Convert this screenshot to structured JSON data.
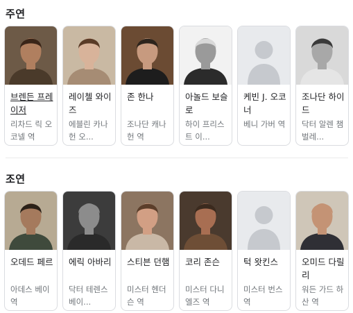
{
  "lead": {
    "title": "주연",
    "cards": [
      {
        "name": "브렌든 프레이저",
        "role": "리차드 릭 오코넬 역",
        "photo": "person-photo",
        "skin": "#b07f5f",
        "hair": "#3a2518",
        "bg": "#6d5a47",
        "shirt": "#4a3a2a"
      },
      {
        "name": "레이첼 와이즈",
        "role": "에블린 카나헌 오...",
        "photo": "person-photo",
        "skin": "#d8b39a",
        "hair": "#5a3b27",
        "bg": "#c9b9a3",
        "shirt": "#a68c74"
      },
      {
        "name": "존 한나",
        "role": "조나단 캐나헌 역",
        "photo": "person-photo",
        "skin": "#c79a7f",
        "hair": "#2d241c",
        "bg": "#6b4b33",
        "shirt": "#1d1d1d"
      },
      {
        "name": "아놀드 보슬로",
        "role": "하이 프리스트 이...",
        "photo": "person-photo-bw",
        "skin": "#9a9a9a",
        "hair": "#d9d9d9",
        "bg": "#f2f2f2",
        "shirt": "#2b2b2b"
      },
      {
        "name": "케빈 J. 오코너",
        "role": "베니 가버 역",
        "photo": "placeholder-avatar",
        "skin": "#d8dbe0",
        "hair": "#d8dbe0",
        "bg": "#e8eaed",
        "shirt": "#d8dbe0"
      },
      {
        "name": "조나단 하이드",
        "role": "닥터 알렌 챔벌레...",
        "photo": "person-photo-bw",
        "skin": "#a8a8a8",
        "hair": "#3a3a3a",
        "bg": "#d9d9d9",
        "shirt": "#e5e5e5"
      }
    ]
  },
  "supporting": {
    "title": "조연",
    "cards": [
      {
        "name": "오데드 페르",
        "role": "아데스 베이 역",
        "photo": "person-photo",
        "skin": "#a57a5d",
        "hair": "#2b2118",
        "bg": "#b7aa93",
        "shirt": "#3f4a3c"
      },
      {
        "name": "에릭 아바리",
        "role": "닥터 테렌스 베이...",
        "photo": "person-photo-bw",
        "skin": "#8c8c8c",
        "hair": "#8c8c8c",
        "bg": "#3c3c3c",
        "shirt": "#2a2a2a"
      },
      {
        "name": "스티븐 던햄",
        "role": "미스터 헨더슨 역",
        "photo": "person-photo",
        "skin": "#d29f84",
        "hair": "#5b3e2a",
        "bg": "#8c7561",
        "shirt": "#c9b8a6"
      },
      {
        "name": "코리 존슨",
        "role": "미스터 다니엘즈 역",
        "photo": "person-photo",
        "skin": "#a86e52",
        "hair": "#3b2a1e",
        "bg": "#4a3a2e",
        "shirt": "#6e4e36"
      },
      {
        "name": "턱 왓킨스",
        "role": "미스터 번스 역",
        "photo": "placeholder-avatar",
        "skin": "#d8dbe0",
        "hair": "#d8dbe0",
        "bg": "#e8eaed",
        "shirt": "#d8dbe0"
      },
      {
        "name": "오미드 다릴리",
        "role": "워든 가드 하산 역",
        "photo": "person-photo",
        "skin": "#c49375",
        "hair": "#c49375",
        "bg": "#cfc6b8",
        "shirt": "#2f2f35"
      }
    ]
  }
}
